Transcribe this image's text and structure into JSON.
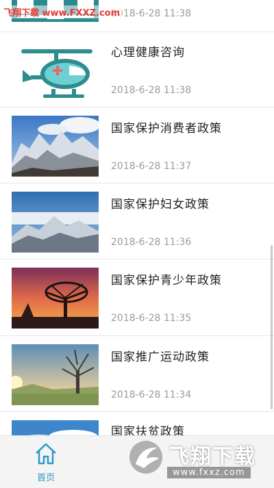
{
  "watermark": {
    "top_text": "飞翔下载 www.FXXZ.com",
    "logo_text": "飞翔下载",
    "logo_url": "www.fxxz.com"
  },
  "articles": [
    {
      "title": "",
      "time": "2018-6-28 11:38",
      "thumb": "building-image"
    },
    {
      "title": "心理健康咨询",
      "time": "2018-6-28 11:38",
      "thumb": "helicopter-icon"
    },
    {
      "title": "国家保护消费者政策",
      "time": "2018-6-28 11:37",
      "thumb": "snowy-mountain-image"
    },
    {
      "title": "国家保护妇女政策",
      "time": "2018-6-28 11:36",
      "thumb": "mountain-clouds-image"
    },
    {
      "title": "国家保护青少年政策",
      "time": "2018-6-28 11:35",
      "thumb": "sunset-tree-image"
    },
    {
      "title": "国家推广运动政策",
      "time": "2018-6-28 11:34",
      "thumb": "bare-tree-image"
    },
    {
      "title": "国家扶贫政策",
      "time": "",
      "thumb": "sky-clouds-image"
    }
  ],
  "tabbar": {
    "home_label": "首页",
    "home_icon": "home-icon",
    "accent": "#2a98c7"
  }
}
